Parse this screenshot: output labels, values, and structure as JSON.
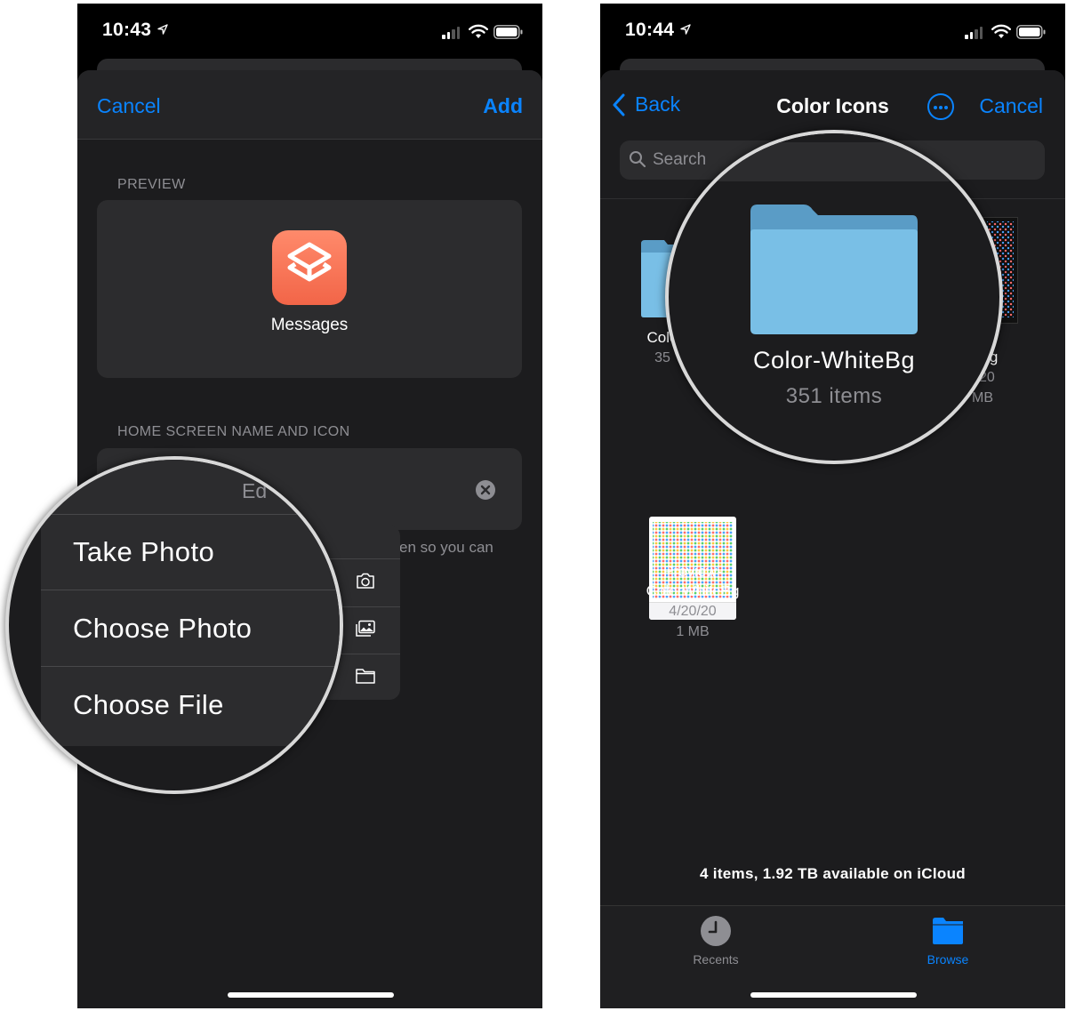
{
  "left_screen": {
    "status": {
      "time": "10:43"
    },
    "nav": {
      "cancel_label": "Cancel",
      "add_label": "Add"
    },
    "preview": {
      "section_label": "PREVIEW",
      "app_name": "Messages"
    },
    "home_screen": {
      "section_label": "HOME SCREEN NAME AND ICON",
      "field_fragment": "Ed",
      "footnote_fragment": "en so you can"
    },
    "menu": {
      "items": [
        {
          "label": "Take Photo",
          "icon": "camera-icon"
        },
        {
          "label": "Choose Photo",
          "icon": "photo-icon"
        },
        {
          "label": "Choose File",
          "icon": "folder-icon"
        }
      ]
    },
    "colors": {
      "accent": "#0a84ff",
      "app_icon": "#f26548"
    }
  },
  "right_screen": {
    "status": {
      "time": "10:44"
    },
    "nav": {
      "back_label": "Back",
      "title": "Color Icons",
      "cancel_label": "Cancel"
    },
    "search": {
      "placeholder": "Search"
    },
    "files": [
      {
        "name_fragment": "Colo",
        "meta_fragment": "35"
      },
      {
        "name": "Color-WhiteBg",
        "count": "351 items"
      },
      {
        "name_fragment": "kBg",
        "date_fragment": "20",
        "size_fragment": "MB"
      },
      {
        "name_line1": "Preview-",
        "name_line2": "ColorWhiteBg",
        "date": "4/20/20",
        "size": "1 MB"
      }
    ],
    "storage_text": "4 items, 1.92 TB available on iCloud",
    "tabs": [
      {
        "label": "Recents",
        "icon": "clock-icon",
        "active": false
      },
      {
        "label": "Browse",
        "icon": "folder-icon",
        "active": true
      }
    ]
  }
}
